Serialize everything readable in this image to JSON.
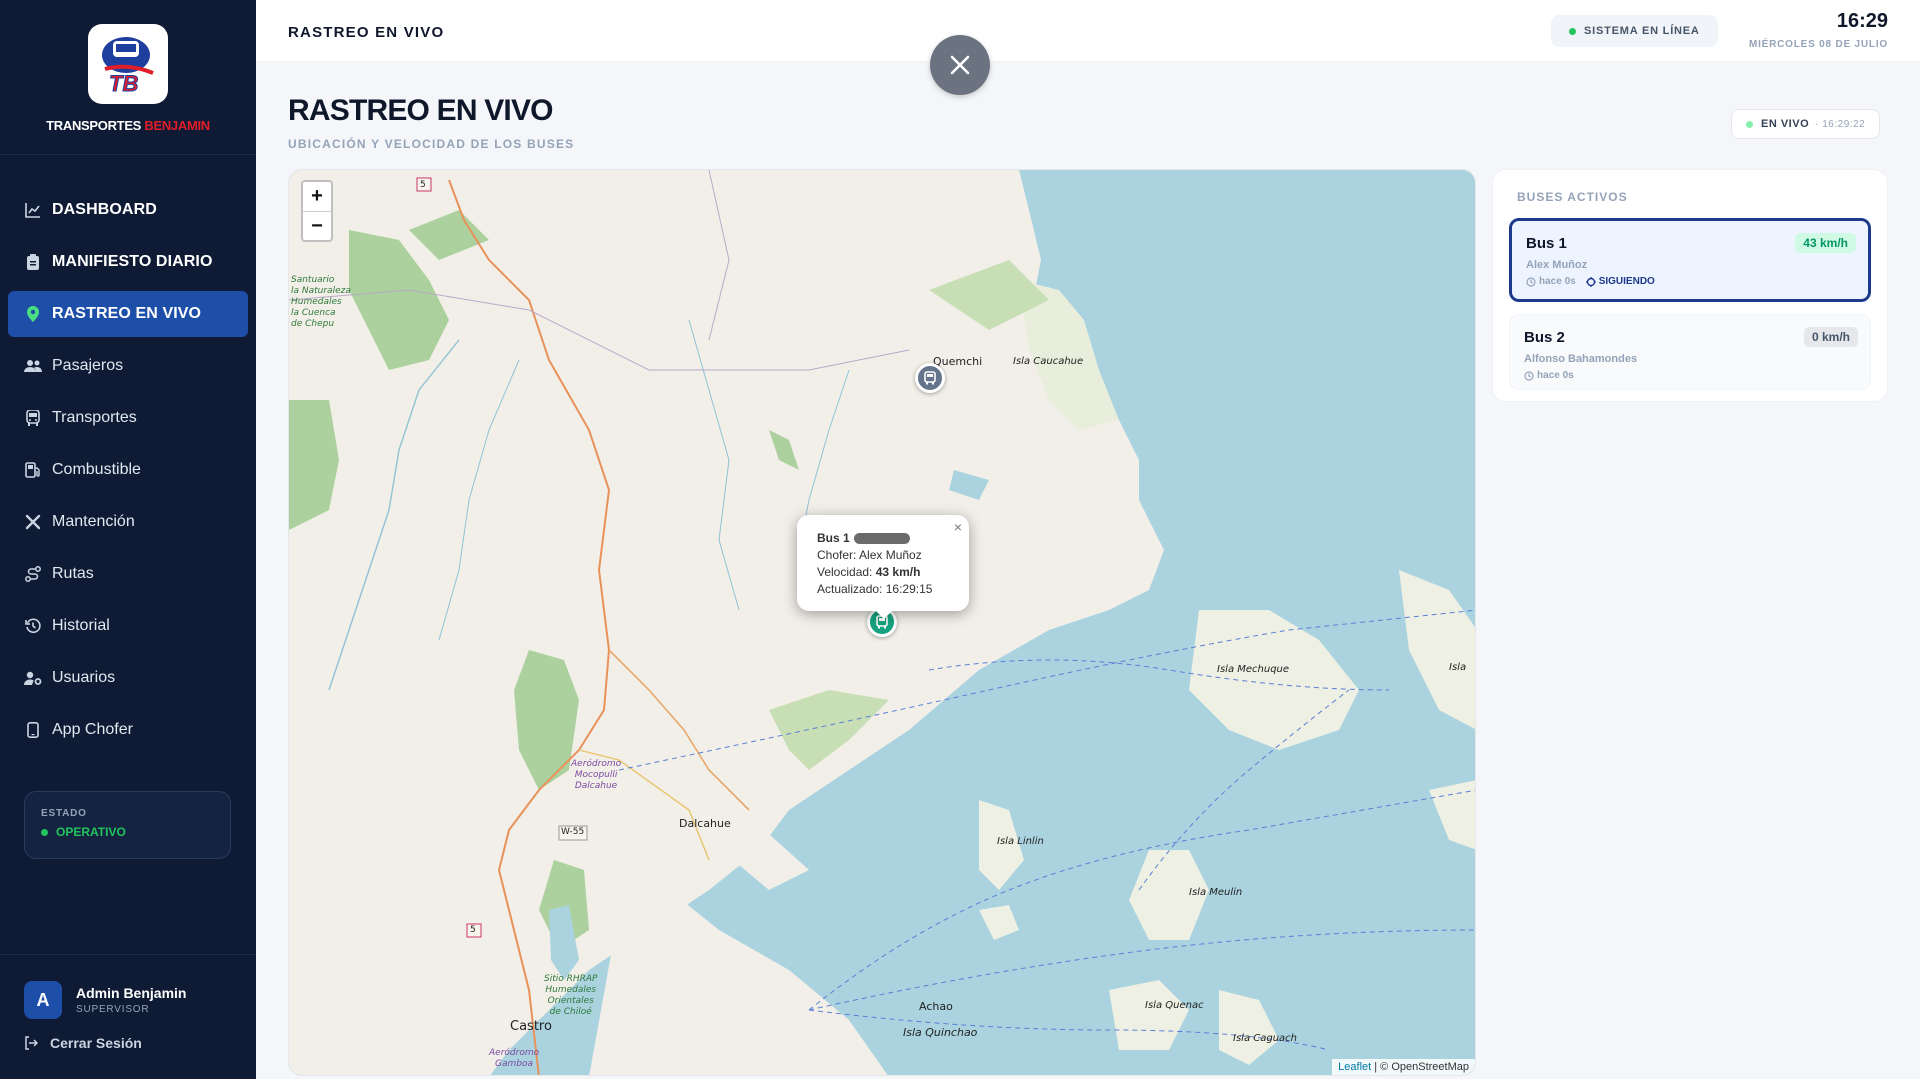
{
  "brand": {
    "name_part1": "TRANSPORTES ",
    "name_part2": "BENJAMIN",
    "logo_text": "TB"
  },
  "nav": [
    {
      "label": "DASHBOARD",
      "icon": "chart-line-icon"
    },
    {
      "label": "MANIFIESTO DIARIO",
      "icon": "clipboard-icon"
    },
    {
      "label": "RASTREO EN VIVO",
      "icon": "map-pin-icon"
    },
    {
      "label": "Pasajeros",
      "icon": "users-icon"
    },
    {
      "label": "Transportes",
      "icon": "bus-icon"
    },
    {
      "label": "Combustible",
      "icon": "fuel-pump-icon"
    },
    {
      "label": "Mantención",
      "icon": "wrench-icon"
    },
    {
      "label": "Rutas",
      "icon": "route-icon"
    },
    {
      "label": "Historial",
      "icon": "history-icon"
    },
    {
      "label": "Usuarios",
      "icon": "user-gear-icon"
    },
    {
      "label": "App Chofer",
      "icon": "mobile-icon"
    }
  ],
  "status": {
    "label": "ESTADO",
    "value": "OPERATIVO",
    "color": "#22c55e"
  },
  "user": {
    "initial": "A",
    "name": "Admin Benjamin",
    "role": "SUPERVISOR",
    "logout": "Cerrar Sesión"
  },
  "topbar": {
    "title": "RASTREO EN VIVO",
    "system": "SISTEMA EN LÍNEA",
    "time": "16:29",
    "date": "MIÉRCOLES 08 DE JULIO"
  },
  "page": {
    "title": "RASTREO EN VIVO",
    "subtitle": "UBICACIÓN Y VELOCIDAD DE LOS BUSES",
    "live_label": "EN VIVO",
    "live_time": "· 16:29:22"
  },
  "map": {
    "zoom_in": "+",
    "zoom_out": "−",
    "labels": {
      "quemchi": "Quemchi",
      "isla_caucahue": "Isla Caucahue",
      "dalcahue": "Dalcahue",
      "castro": "Castro",
      "achao": "Achao",
      "isla_quinchao": "Isla Quinchao",
      "isla_mechuque": "Isla Mechuque",
      "isla_linlin": "Isla Linlin",
      "isla_meulin": "Isla Meulin",
      "isla_quenac": "Isla Quenac",
      "isla_caguach": "Isla Caguach",
      "isla_edge": "Isla",
      "santuario": "Santuario\nla Naturaleza\nHumedales\nla Cuenca\nde Chepu",
      "aerodromo_mocopulli": "Aeródromo\nMocopulli\nDalcahue",
      "sitio_rhrap": "Sitio RHRAP\nHumedales\nOrientales\nde Chiloé",
      "aerodromo_gamboa": "Aeródromo\nGamboa",
      "route5_top": "5",
      "route5_bottom": "5",
      "w55": "W-55"
    },
    "popup": {
      "bus": "Bus 1",
      "driver_label": "Chofer: ",
      "driver": "Alex Muñoz",
      "speed_label": "Velocidad: ",
      "speed": "43 km/h",
      "updated_label": "Actualizado: ",
      "updated": "16:29:15",
      "close": "×"
    },
    "attribution_leaflet": "Leaflet",
    "attribution_rest": " | © OpenStreetMap"
  },
  "panel": {
    "title": "BUSES ACTIVOS",
    "buses": [
      {
        "name": "Bus 1",
        "driver": "Alex Muñoz",
        "updated": "hace 0s",
        "speed": "43 km/h",
        "following": "SIGUIENDO",
        "status_color": "#059669"
      },
      {
        "name": "Bus 2",
        "driver": "Alfonso Bahamondes",
        "updated": "hace 0s",
        "speed": "0 km/h"
      }
    ]
  }
}
